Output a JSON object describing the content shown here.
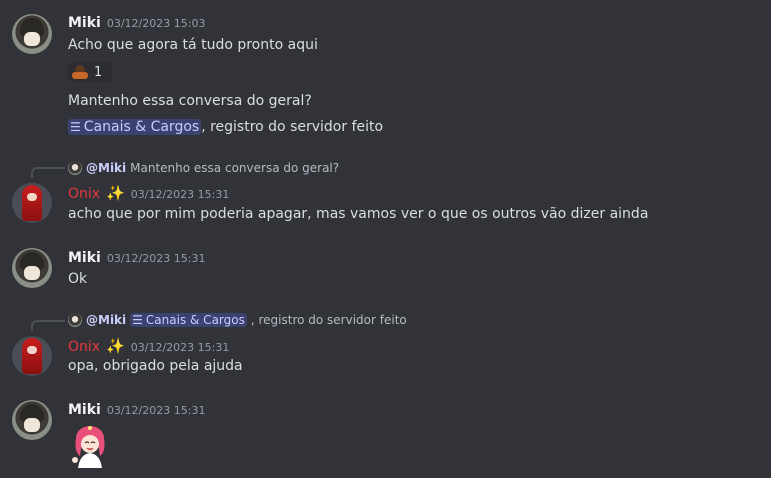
{
  "messages": [
    {
      "author": "Miki",
      "timestamp": "03/12/2023 15:03",
      "lines": [
        "Acho que agora tá tudo pronto aqui"
      ],
      "reaction_count": "1",
      "line2": "Mantenho essa conversa do geral?",
      "channel_mention": "Canais & Cargos",
      "line3_suffix": ", registro do servidor feito"
    },
    {
      "reply_to": "@Miki",
      "reply_text": "Mantenho essa conversa do geral?",
      "author": "Onix",
      "timestamp": "03/12/2023 15:31",
      "text": "acho que por mim poderia apagar, mas vamos ver o que os outros vão dizer ainda"
    },
    {
      "author": "Miki",
      "timestamp": "03/12/2023 15:31",
      "text": "Ok"
    },
    {
      "reply_to": "@Miki",
      "reply_channel": "Canais & Cargos",
      "reply_suffix": ", registro do servidor feito",
      "author": "Onix",
      "timestamp": "03/12/2023 15:31",
      "text": "opa, obrigado pela ajuda"
    },
    {
      "author": "Miki",
      "timestamp": "03/12/2023 15:31",
      "sticker": "anime-girl-sticker"
    }
  ],
  "colors": {
    "background": "#313338",
    "onix_name": "#e8383d",
    "mention_bg": "#3c4270",
    "mention_text": "#c9cdfb"
  }
}
